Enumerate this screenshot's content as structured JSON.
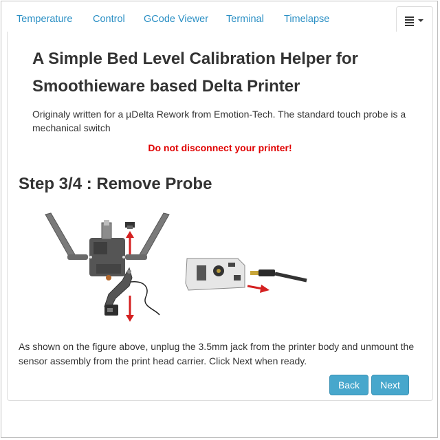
{
  "tabs": [
    {
      "label": "Temperature"
    },
    {
      "label": "Control"
    },
    {
      "label": "GCode Viewer"
    },
    {
      "label": "Terminal"
    },
    {
      "label": "Timelapse"
    }
  ],
  "tab_menu_icon": "list-icon",
  "content": {
    "title": "A Simple Bed Level Calibration Helper for Smoothieware based Delta Printer",
    "intro": "Originaly written for a µDelta Rework from Emotion-Tech. The standard touch probe is a mechanical switch",
    "warning": "Do not disconnect your printer!",
    "step_title": "Step 3/4 : Remove Probe",
    "description": "As shown on the figure above, unplug the 3.5mm jack from the printer body and unmount the sensor assembly from the print head carrier. Click Next when ready."
  },
  "buttons": {
    "back": "Back",
    "next": "Next"
  },
  "colors": {
    "link": "#2a8fc4",
    "warning": "#e00000",
    "button": "#47a7cc",
    "arrow": "#d42020"
  }
}
